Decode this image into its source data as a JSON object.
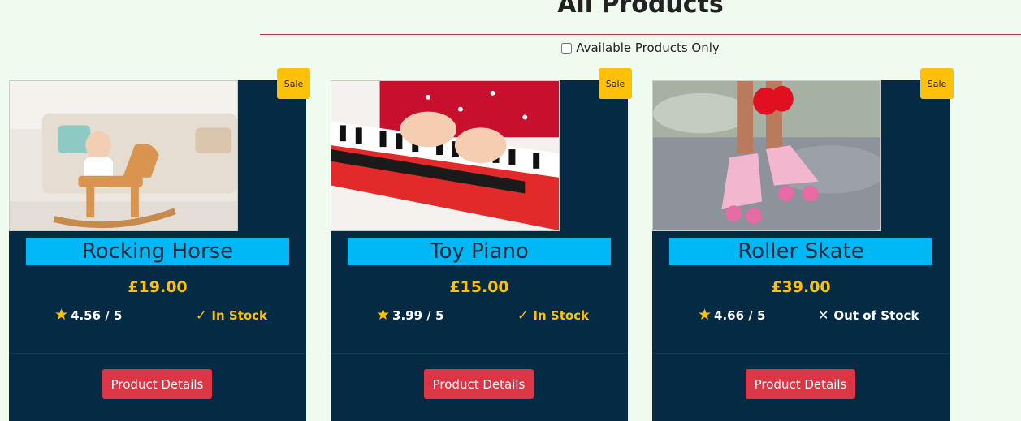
{
  "page": {
    "title": "All Products",
    "filter_label": "Available Products Only",
    "filter_checked": false
  },
  "products": [
    {
      "name": "Rocking Horse",
      "price": "£19.00",
      "rating": "4.56 / 5",
      "stock": "In Stock",
      "stock_icon": "check-icon",
      "in_stock": true,
      "badge": "Sale",
      "button": "Product Details"
    },
    {
      "name": "Toy Piano",
      "price": "£15.00",
      "rating": "3.99 / 5",
      "stock": "In Stock",
      "stock_icon": "check-icon",
      "in_stock": true,
      "badge": "Sale",
      "button": "Product Details"
    },
    {
      "name": "Roller Skate",
      "price": "£39.00",
      "rating": "4.66 / 5",
      "stock": "Out of Stock",
      "stock_icon": "x-icon",
      "in_stock": false,
      "badge": "Sale",
      "button": "Product Details"
    }
  ],
  "colors": {
    "page_bg": "#f0fbef",
    "card_bg": "#042a44",
    "name_bg": "#00b8f5",
    "accent": "#ffc107",
    "button": "#dc3545",
    "rule": "#b33a3a"
  }
}
